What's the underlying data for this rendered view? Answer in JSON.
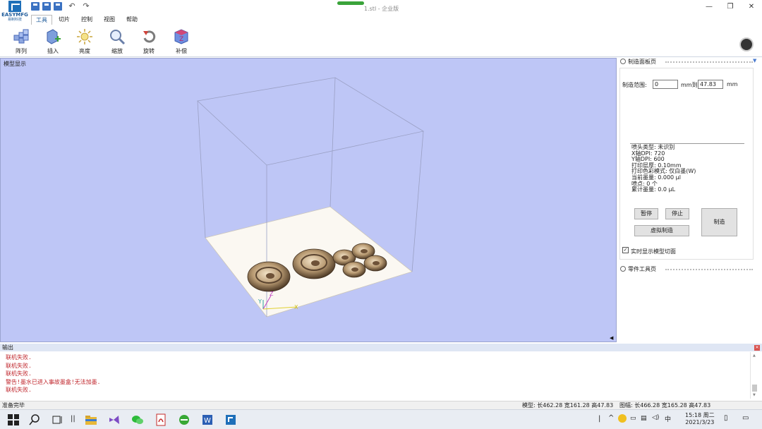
{
  "app": {
    "logo_name": "EASYMFG",
    "logo_sub": "易制科技",
    "doc_title": "1.stl - 企业版"
  },
  "menu": [
    "工具",
    "切片",
    "控制",
    "视图",
    "帮助"
  ],
  "toolbar": {
    "tools": [
      {
        "label": "阵列",
        "icon": "array-icon"
      },
      {
        "label": "插入",
        "icon": "insert-icon"
      },
      {
        "label": "亮度",
        "icon": "brightness-icon"
      },
      {
        "label": "缩放",
        "icon": "zoom-icon"
      },
      {
        "label": "旋转",
        "icon": "rotate-icon"
      },
      {
        "label": "补偿",
        "icon": "compensate-icon"
      }
    ]
  },
  "viewport": {
    "title": "模型显示",
    "axes": {
      "y": "Y",
      "z": "Z",
      "x": "X"
    }
  },
  "panel": {
    "title": "制造面板页",
    "range_label": "制造范围:",
    "range_from": "0",
    "range_mid": "mm到",
    "range_to": "47.83",
    "range_unit": "mm",
    "info_lines": [
      "喷头类型: 未识别",
      "X轴DPI: 720",
      "Y轴DPI: 600",
      "打印层厚: 0.10mm",
      "打印色彩模式: 仅白墨(W)",
      "当前墨量: 0.000 μl",
      "喷点: 0 个",
      "累计墨量: 0.0 μL"
    ],
    "pause_label": "暂停",
    "stop_label": "停止",
    "virtual_label": "虚拟制造",
    "manufacture_label": "制造",
    "realtime_label": "实时显示模型切面",
    "realtime_checked": true,
    "parts_title": "零件工具页"
  },
  "output": {
    "title": "输出",
    "lines": [
      "联机失败.",
      "联机失败.",
      "联机失败.",
      "警告!墨水已进入事故墨盒!无法加墨.",
      "联机失败."
    ]
  },
  "status": {
    "ready": "准备完毕",
    "model": "模型: 长462.28 宽161.28 高47.83",
    "drawing": "图幅: 长466.28 宽165.28 高47.83"
  },
  "taskbar": {
    "time": "15:18 周二",
    "date": "2021/3/23"
  },
  "colors": {
    "viewport_bg": "#bec6f6",
    "platform": "#fbf8f2",
    "model": "#b99b73",
    "error_text": "#c0272d"
  }
}
